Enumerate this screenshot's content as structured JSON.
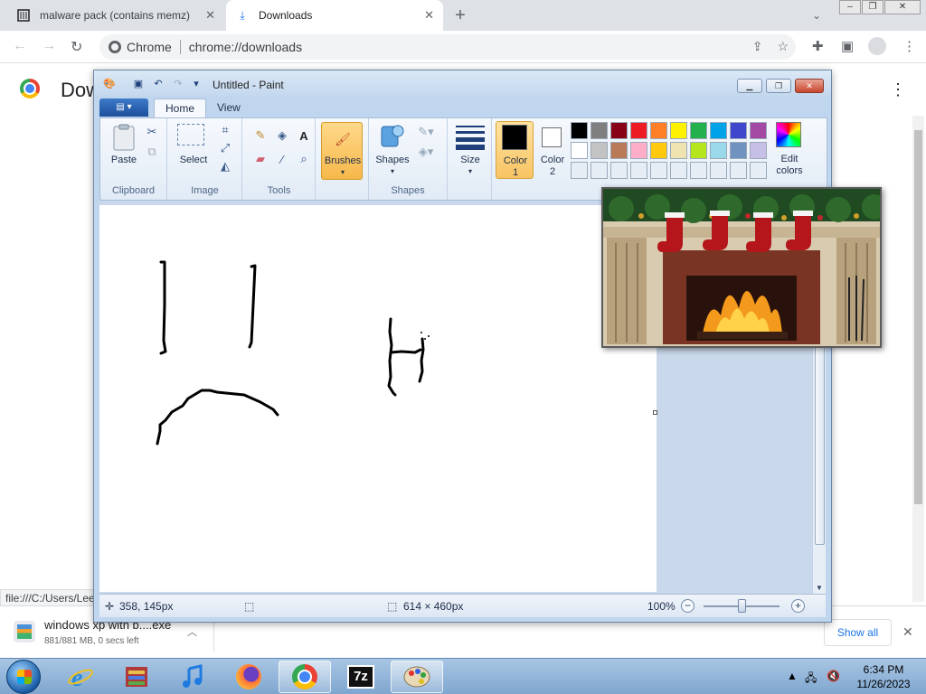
{
  "browser": {
    "tabs": [
      {
        "title": "malware pack (contains memz) :",
        "icon": "archive-icon",
        "active": false
      },
      {
        "title": "Downloads",
        "icon": "download-icon",
        "active": true
      }
    ],
    "new_tab_symbol": "+",
    "omnibox": {
      "chip": "Chrome",
      "url": "chrome://downloads"
    }
  },
  "downloads_page": {
    "title": "Downloads",
    "status_url": "file:///C:/Users/Lee"
  },
  "download_shelf": {
    "item": {
      "name": "windows xp with b....exe",
      "meta": "881/881 MB, 0 secs left"
    },
    "show_all_label": "Show all"
  },
  "paint": {
    "window_title": "Untitled - Paint",
    "tabs": [
      "Home",
      "View"
    ],
    "groups": {
      "clipboard": {
        "label": "Clipboard",
        "paste_label": "Paste"
      },
      "image": {
        "label": "Image",
        "select_label": "Select"
      },
      "tools": {
        "label": "Tools"
      },
      "brushes_label": "Brushes",
      "shapes": {
        "label": "Shapes",
        "button_label": "Shapes"
      },
      "size_label": "Size",
      "color1_label_a": "Color",
      "color1_label_b": "1",
      "color2_label_a": "Color",
      "color2_label_b": "2",
      "edit_colors_a": "Edit",
      "edit_colors_b": "colors"
    },
    "palette_row1": [
      "#000000",
      "#7f7f7f",
      "#880015",
      "#ed1c24",
      "#ff7f27",
      "#fff200",
      "#22b14c",
      "#00a2e8",
      "#3f48cc",
      "#a349a4"
    ],
    "palette_row2": [
      "#ffffff",
      "#c3c3c3",
      "#b97a57",
      "#ffaec9",
      "#ffc90e",
      "#efe4b0",
      "#b5e61d",
      "#99d9ea",
      "#7092be",
      "#c8bfe7"
    ],
    "color1": "#000000",
    "color2": "#ffffff",
    "status": {
      "cursor_pos": "358, 145px",
      "canvas_size": "614 × 460px",
      "zoom": "100%"
    }
  },
  "taskbar": {
    "apps": [
      "ie-icon",
      "archive-app-icon",
      "itunes-icon",
      "firefox-icon",
      "chrome-icon",
      "7zip-icon",
      "paint-icon"
    ],
    "time": "6:34 PM",
    "date": "11/26/2023"
  }
}
